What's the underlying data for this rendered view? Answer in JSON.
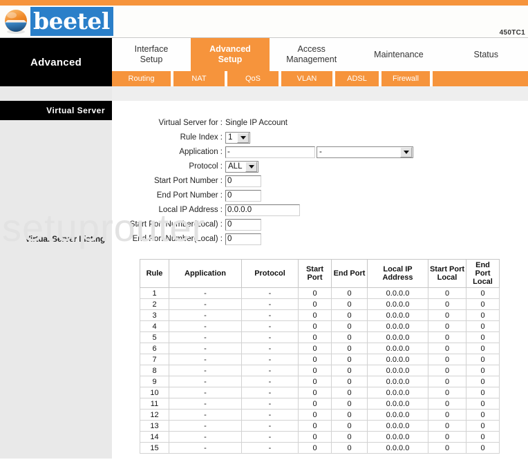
{
  "header": {
    "brand_name": "beetel",
    "model": "450TC1",
    "logo_icon": "sphere-logo-icon"
  },
  "nav": {
    "section_title": "Advanced",
    "tabs": [
      {
        "label": "Interface Setup",
        "line1": "Interface",
        "line2": "Setup",
        "active": false
      },
      {
        "label": "Advanced Setup",
        "line1": "Advanced",
        "line2": "Setup",
        "active": true
      },
      {
        "label": "Access Management",
        "line1": "Access",
        "line2": "Management",
        "active": false
      },
      {
        "label": "Maintenance",
        "line1": "Maintenance",
        "line2": "",
        "active": false
      },
      {
        "label": "Status",
        "line1": "Status",
        "line2": "",
        "active": false
      }
    ],
    "subtabs": [
      {
        "label": "Routing"
      },
      {
        "label": "NAT"
      },
      {
        "label": "QoS"
      },
      {
        "label": "VLAN"
      },
      {
        "label": "ADSL"
      },
      {
        "label": "Firewall"
      }
    ]
  },
  "sidebar": {
    "panel_title": "Virtual Server",
    "listing_label": "Virtual Server Listing"
  },
  "watermark": {
    "text": "setuprouter"
  },
  "form": {
    "virtual_server_for": {
      "label": "Virtual Server for :",
      "value": "Single IP Account"
    },
    "rule_index": {
      "label": "Rule Index :",
      "value": "1"
    },
    "application": {
      "label": "Application :",
      "text_value": "-",
      "select_value": "-"
    },
    "protocol": {
      "label": "Protocol :",
      "value": "ALL"
    },
    "start_port": {
      "label": "Start Port Number :",
      "value": "0"
    },
    "end_port": {
      "label": "End Port Number :",
      "value": "0"
    },
    "local_ip": {
      "label": "Local IP Address :",
      "value": "0.0.0.0"
    },
    "start_port_local": {
      "label": "Start Port Number(Local) :",
      "value": "0"
    },
    "end_port_local": {
      "label": "End Port Number(Local) :",
      "value": "0"
    }
  },
  "listing": {
    "columns": [
      "Rule",
      "Application",
      "Protocol",
      "Start Port",
      "End Port",
      "Local IP Address",
      "Start Port Local",
      "End Port Local"
    ],
    "rows": [
      {
        "rule": "1",
        "application": "-",
        "protocol": "-",
        "start_port": "0",
        "end_port": "0",
        "local_ip": "0.0.0.0",
        "start_port_local": "0",
        "end_port_local": "0"
      },
      {
        "rule": "2",
        "application": "-",
        "protocol": "-",
        "start_port": "0",
        "end_port": "0",
        "local_ip": "0.0.0.0",
        "start_port_local": "0",
        "end_port_local": "0"
      },
      {
        "rule": "3",
        "application": "-",
        "protocol": "-",
        "start_port": "0",
        "end_port": "0",
        "local_ip": "0.0.0.0",
        "start_port_local": "0",
        "end_port_local": "0"
      },
      {
        "rule": "4",
        "application": "-",
        "protocol": "-",
        "start_port": "0",
        "end_port": "0",
        "local_ip": "0.0.0.0",
        "start_port_local": "0",
        "end_port_local": "0"
      },
      {
        "rule": "5",
        "application": "-",
        "protocol": "-",
        "start_port": "0",
        "end_port": "0",
        "local_ip": "0.0.0.0",
        "start_port_local": "0",
        "end_port_local": "0"
      },
      {
        "rule": "6",
        "application": "-",
        "protocol": "-",
        "start_port": "0",
        "end_port": "0",
        "local_ip": "0.0.0.0",
        "start_port_local": "0",
        "end_port_local": "0"
      },
      {
        "rule": "7",
        "application": "-",
        "protocol": "-",
        "start_port": "0",
        "end_port": "0",
        "local_ip": "0.0.0.0",
        "start_port_local": "0",
        "end_port_local": "0"
      },
      {
        "rule": "8",
        "application": "-",
        "protocol": "-",
        "start_port": "0",
        "end_port": "0",
        "local_ip": "0.0.0.0",
        "start_port_local": "0",
        "end_port_local": "0"
      },
      {
        "rule": "9",
        "application": "-",
        "protocol": "-",
        "start_port": "0",
        "end_port": "0",
        "local_ip": "0.0.0.0",
        "start_port_local": "0",
        "end_port_local": "0"
      },
      {
        "rule": "10",
        "application": "-",
        "protocol": "-",
        "start_port": "0",
        "end_port": "0",
        "local_ip": "0.0.0.0",
        "start_port_local": "0",
        "end_port_local": "0"
      },
      {
        "rule": "11",
        "application": "-",
        "protocol": "-",
        "start_port": "0",
        "end_port": "0",
        "local_ip": "0.0.0.0",
        "start_port_local": "0",
        "end_port_local": "0"
      },
      {
        "rule": "12",
        "application": "-",
        "protocol": "-",
        "start_port": "0",
        "end_port": "0",
        "local_ip": "0.0.0.0",
        "start_port_local": "0",
        "end_port_local": "0"
      },
      {
        "rule": "13",
        "application": "-",
        "protocol": "-",
        "start_port": "0",
        "end_port": "0",
        "local_ip": "0.0.0.0",
        "start_port_local": "0",
        "end_port_local": "0"
      },
      {
        "rule": "14",
        "application": "-",
        "protocol": "-",
        "start_port": "0",
        "end_port": "0",
        "local_ip": "0.0.0.0",
        "start_port_local": "0",
        "end_port_local": "0"
      },
      {
        "rule": "15",
        "application": "-",
        "protocol": "-",
        "start_port": "0",
        "end_port": "0",
        "local_ip": "0.0.0.0",
        "start_port_local": "0",
        "end_port_local": "0"
      }
    ]
  },
  "colors": {
    "accent_orange": "#F6943C",
    "brand_blue": "#2A7FC9",
    "panel_black": "#000000",
    "sidebar_gray": "#E9E9E9"
  }
}
